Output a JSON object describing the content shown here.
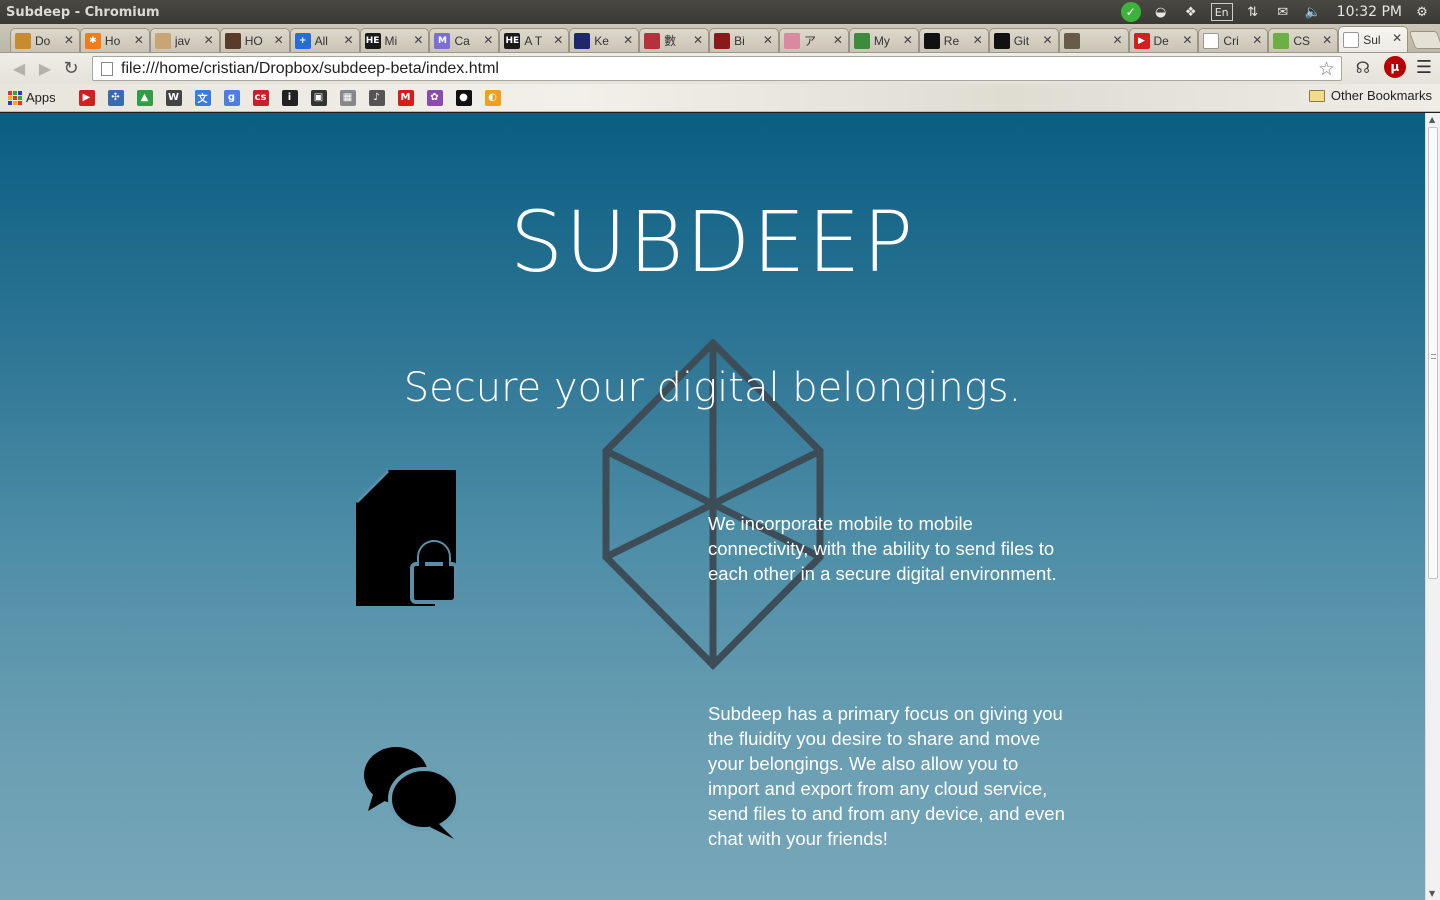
{
  "os": {
    "window_title": "Subdeep - Chromium",
    "lang": "En",
    "clock": "10:32 PM"
  },
  "tabs": [
    {
      "label": "Do",
      "color": "#c98b2f",
      "glyph": ""
    },
    {
      "label": "Ho",
      "color": "#f07c1b",
      "glyph": "✱"
    },
    {
      "label": "jav",
      "color": "#c9a575",
      "glyph": ""
    },
    {
      "label": "HO",
      "color": "#5a3a2a",
      "glyph": ""
    },
    {
      "label": "All",
      "color": "#2a6cd6",
      "glyph": "+"
    },
    {
      "label": "Mi",
      "color": "#1a1a1a",
      "glyph": "HE"
    },
    {
      "label": "Ca",
      "color": "#7b6fd0",
      "glyph": "M"
    },
    {
      "label": "A T",
      "color": "#1a1a1a",
      "glyph": "HE"
    },
    {
      "label": "Ke",
      "color": "#1c2a6b",
      "glyph": ""
    },
    {
      "label": "數",
      "color": "#b6323a",
      "glyph": ""
    },
    {
      "label": "Bi",
      "color": "#8a1a1a",
      "glyph": ""
    },
    {
      "label": "ア",
      "color": "#d98aa0",
      "glyph": ""
    },
    {
      "label": "My",
      "color": "#3c8c3c",
      "glyph": ""
    },
    {
      "label": "Re",
      "color": "#111111",
      "glyph": ""
    },
    {
      "label": "Git",
      "color": "#111111",
      "glyph": ""
    },
    {
      "label": "",
      "color": "#6a5a4a",
      "glyph": ""
    },
    {
      "label": "De",
      "color": "#d21f1f",
      "glyph": "▶"
    },
    {
      "label": "Cri",
      "color": "#ffffff",
      "glyph": ""
    },
    {
      "label": "CS",
      "color": "#6ab042",
      "glyph": ""
    },
    {
      "label": "Sul",
      "color": "#ffffff",
      "glyph": ""
    }
  ],
  "toolbar": {
    "url": "file:///home/cristian/Dropbox/subdeep-beta/index.html"
  },
  "bookmarks": {
    "apps_label": "Apps",
    "items": [
      {
        "name": "youtube",
        "color": "#d21f1f",
        "glyph": "▶"
      },
      {
        "name": "bookmark-2",
        "color": "#3a6ab0",
        "glyph": "✣"
      },
      {
        "name": "google-drive",
        "color": "#2f9e44",
        "glyph": "▲"
      },
      {
        "name": "wikipedia",
        "color": "#444444",
        "glyph": "W"
      },
      {
        "name": "translate",
        "color": "#3b7be0",
        "glyph": "文"
      },
      {
        "name": "google",
        "color": "#4a7fe0",
        "glyph": "g"
      },
      {
        "name": "bookmark-7",
        "color": "#c8202a",
        "glyph": "cs"
      },
      {
        "name": "info",
        "color": "#222222",
        "glyph": "i"
      },
      {
        "name": "bookmark-9",
        "color": "#333333",
        "glyph": "▣"
      },
      {
        "name": "bookmark-10",
        "color": "#888888",
        "glyph": "▦"
      },
      {
        "name": "music",
        "color": "#555555",
        "glyph": "♪"
      },
      {
        "name": "bookmark-12",
        "color": "#d81c1c",
        "glyph": "M"
      },
      {
        "name": "bookmark-13",
        "color": "#8a4ab0",
        "glyph": "✿"
      },
      {
        "name": "github",
        "color": "#111111",
        "glyph": "●"
      },
      {
        "name": "bookmark-15",
        "color": "#f0a01b",
        "glyph": "◐"
      }
    ],
    "other_label": "Other Bookmarks"
  },
  "page": {
    "title": "SUBDEEP",
    "tagline": "Secure your digital belongings.",
    "features": [
      {
        "icon": "locked-file-icon",
        "text": "We incorporate mobile to mobile connectivity, with the ability to send files to each other in a secure digital environment."
      },
      {
        "icon": "chat-bubbles-icon",
        "text": "Subdeep has a primary focus on giving you the fluidity you desire to share and move your belongings. We also allow you to import and export from any cloud service, send files to and from any device, and even chat with your friends!"
      }
    ]
  },
  "colors": {
    "page_gradient_top": "#0a5e82",
    "page_gradient_bottom": "#77a7b9",
    "cube_stroke": "#3c4d57"
  }
}
